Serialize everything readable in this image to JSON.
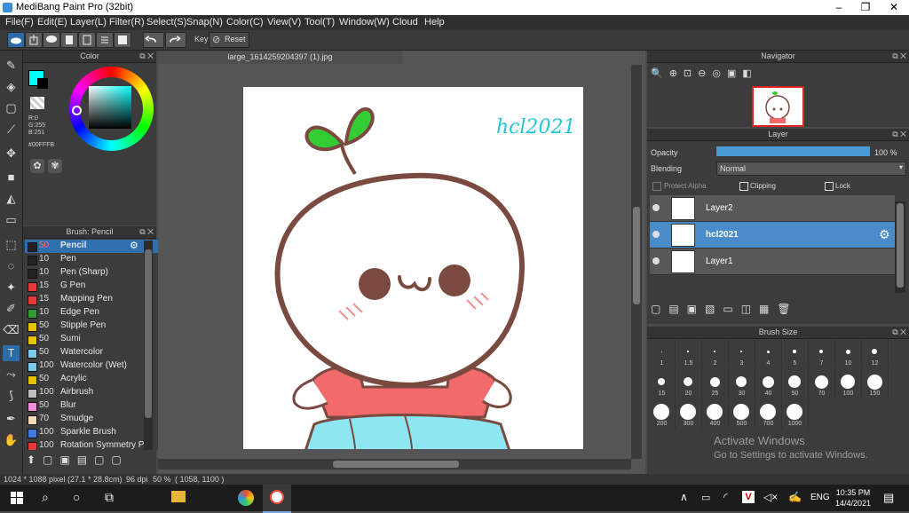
{
  "window": {
    "title": "MediBang Paint Pro (32bit)",
    "minimize": "–",
    "maximize": "❐",
    "close": "✕"
  },
  "menu": [
    "File(F)",
    "Edit(E)",
    "Layer(L)",
    "Filter(R)",
    "Select(S)",
    "Snap(N)",
    "Color(C)",
    "View(V)",
    "Tool(T)",
    "Window(W)",
    "Cloud",
    "Help"
  ],
  "toolbar": {
    "key_label": "Key",
    "reset_label": "Reset"
  },
  "color_panel": {
    "title": "Color",
    "r": "R:0",
    "g": "G:255",
    "b": "B:251",
    "hex": "#00FFFB",
    "fg_color": "#00fffb"
  },
  "brush_panel": {
    "title": "Brush: Pencil",
    "items": [
      {
        "size": "50",
        "name": "Pencil",
        "color": "#222222"
      },
      {
        "size": "10",
        "name": "Pen",
        "color": "#222222"
      },
      {
        "size": "10",
        "name": "Pen (Sharp)",
        "color": "#222222"
      },
      {
        "size": "15",
        "name": "G Pen",
        "color": "#e53935"
      },
      {
        "size": "15",
        "name": "Mapping Pen",
        "color": "#e53935"
      },
      {
        "size": "10",
        "name": "Edge Pen",
        "color": "#2e9c2e"
      },
      {
        "size": "50",
        "name": "Stipple Pen",
        "color": "#e8c400"
      },
      {
        "size": "50",
        "name": "Sumi",
        "color": "#e8c400"
      },
      {
        "size": "50",
        "name": "Watercolor",
        "color": "#7ac9ef"
      },
      {
        "size": "100",
        "name": "Watercolor (Wet)",
        "color": "#7ac9ef"
      },
      {
        "size": "50",
        "name": "Acrylic",
        "color": "#e8c400"
      },
      {
        "size": "100",
        "name": "Airbrush",
        "color": "#bdbdbd"
      },
      {
        "size": "50",
        "name": "Blur",
        "color": "#f48fe0"
      },
      {
        "size": "70",
        "name": "Smudge",
        "color": "#f5d9b5"
      },
      {
        "size": "100",
        "name": "Sparkle Brush",
        "color": "#3f7be0"
      },
      {
        "size": "100",
        "name": "Rotation Symmetry Pa",
        "color": "#e53935"
      }
    ]
  },
  "document": {
    "tab": "large_1614259204397 (1).jpg",
    "watermark": "hcl2021"
  },
  "navigator": {
    "title": "Navigator"
  },
  "layer_panel": {
    "title": "Layer",
    "opacity_label": "Opacity",
    "opacity_value": "100 %",
    "opacity_fraction": 1.0,
    "blending_label": "Blending",
    "blending_value": "Normal",
    "protect_alpha": "Protect Alpha",
    "clipping": "Clipping",
    "lock": "Lock",
    "layers": [
      {
        "name": "Layer2",
        "selected": false
      },
      {
        "name": "hcl2021",
        "selected": true
      },
      {
        "name": "Layer1",
        "selected": false
      }
    ]
  },
  "brush_size": {
    "title": "Brush Size",
    "sizes": [
      "1",
      "1.5",
      "2",
      "3",
      "4",
      "5",
      "7",
      "10",
      "12",
      "15",
      "20",
      "25",
      "30",
      "40",
      "50",
      "70",
      "100",
      "150",
      "200",
      "300",
      "400",
      "500",
      "700",
      "1000"
    ]
  },
  "watermark_os": {
    "line1": "Activate Windows",
    "line2": "Go to Settings to activate Windows."
  },
  "status": {
    "size": "1024 * 1088 pixel",
    "cm": "(27.1 * 28.8cm)",
    "dpi": "96 dpi",
    "zoom": "50 %",
    "coords": "( 1058, 1100 )"
  },
  "taskbar": {
    "lang": "ENG",
    "time": "10:35 PM",
    "date": "14/4/2021"
  }
}
